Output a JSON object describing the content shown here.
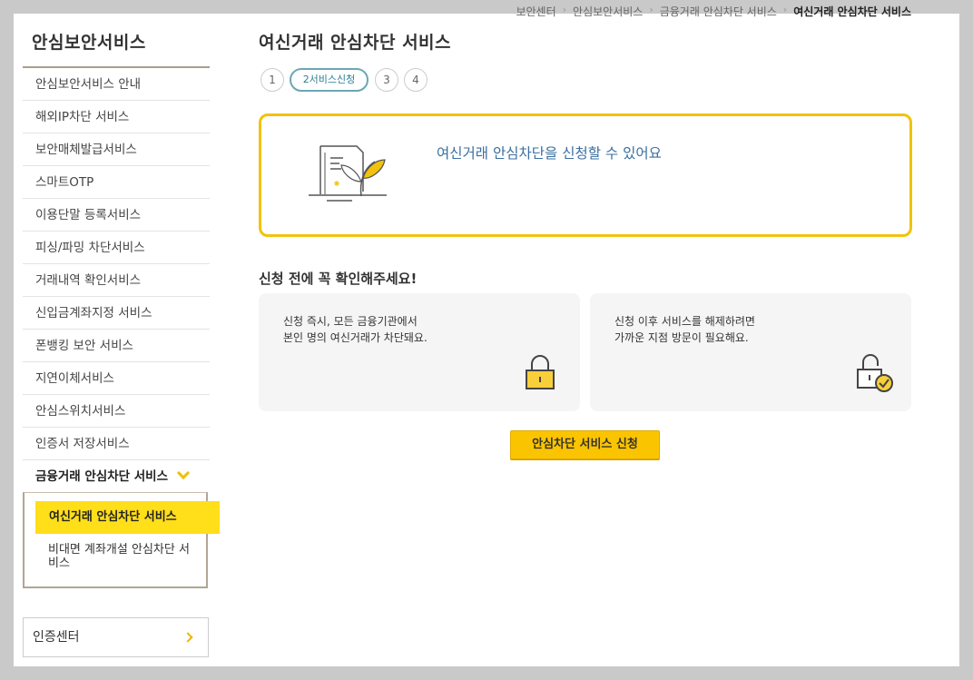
{
  "breadcrumb": [
    "보안센터",
    "안심보안서비스",
    "금융거래 안심차단 서비스",
    "여신거래 안심차단 서비스"
  ],
  "breadcrumb_separator": "›",
  "sidebar": {
    "title": "안심보안서비스",
    "items": [
      {
        "label": "안심보안서비스 안내"
      },
      {
        "label": "해외IP차단 서비스"
      },
      {
        "label": "보안매체발급서비스"
      },
      {
        "label": "스마트OTP"
      },
      {
        "label": "이용단말 등록서비스"
      },
      {
        "label": "피싱/파밍 차단서비스"
      },
      {
        "label": "거래내역 확인서비스"
      },
      {
        "label": "신입금계좌지정 서비스"
      },
      {
        "label": "폰뱅킹 보안 서비스"
      },
      {
        "label": "지연이체서비스"
      },
      {
        "label": "안심스위치서비스"
      },
      {
        "label": "인증서 저장서비스"
      },
      {
        "label": "금융거래 안심차단 서비스",
        "expanded": true
      }
    ],
    "sub_items": [
      {
        "label": "여신거래 안심차단 서비스",
        "active": true
      },
      {
        "label": "비대면 계좌개설 안심차단 서비스"
      }
    ],
    "cert_center": {
      "label": "인증센터",
      "icon": "chevron-right-icon"
    }
  },
  "main": {
    "title": "여신거래 안심차단 서비스",
    "steps": [
      {
        "label": "1"
      },
      {
        "label": "2서비스신청",
        "current": true
      },
      {
        "label": "3"
      },
      {
        "label": "4"
      }
    ],
    "notice": {
      "text": "여신거래 안심차단을 신청할 수 있어요",
      "icon": "document-leaf-icon"
    },
    "section_title": "신청 전에 꼭 확인해주세요!",
    "cards": [
      {
        "line1": "신청 즉시, 모든 금융기관에서",
        "line2": "본인 명의 여신거래가 차단돼요.",
        "icon": "lock-icon"
      },
      {
        "line1": "신청 이후 서비스를 해제하려면",
        "line2": "가까운 지점 방문이 필요해요.",
        "icon": "unlock-check-icon"
      }
    ],
    "apply_button": "안심차단 서비스 신청"
  },
  "colors": {
    "accent_yellow": "#fbc400",
    "notice_border": "#f2c20c",
    "notice_text": "#3a6fa0",
    "step_active": "#6ba7b3",
    "frame_bg": "#c9c9c9"
  }
}
